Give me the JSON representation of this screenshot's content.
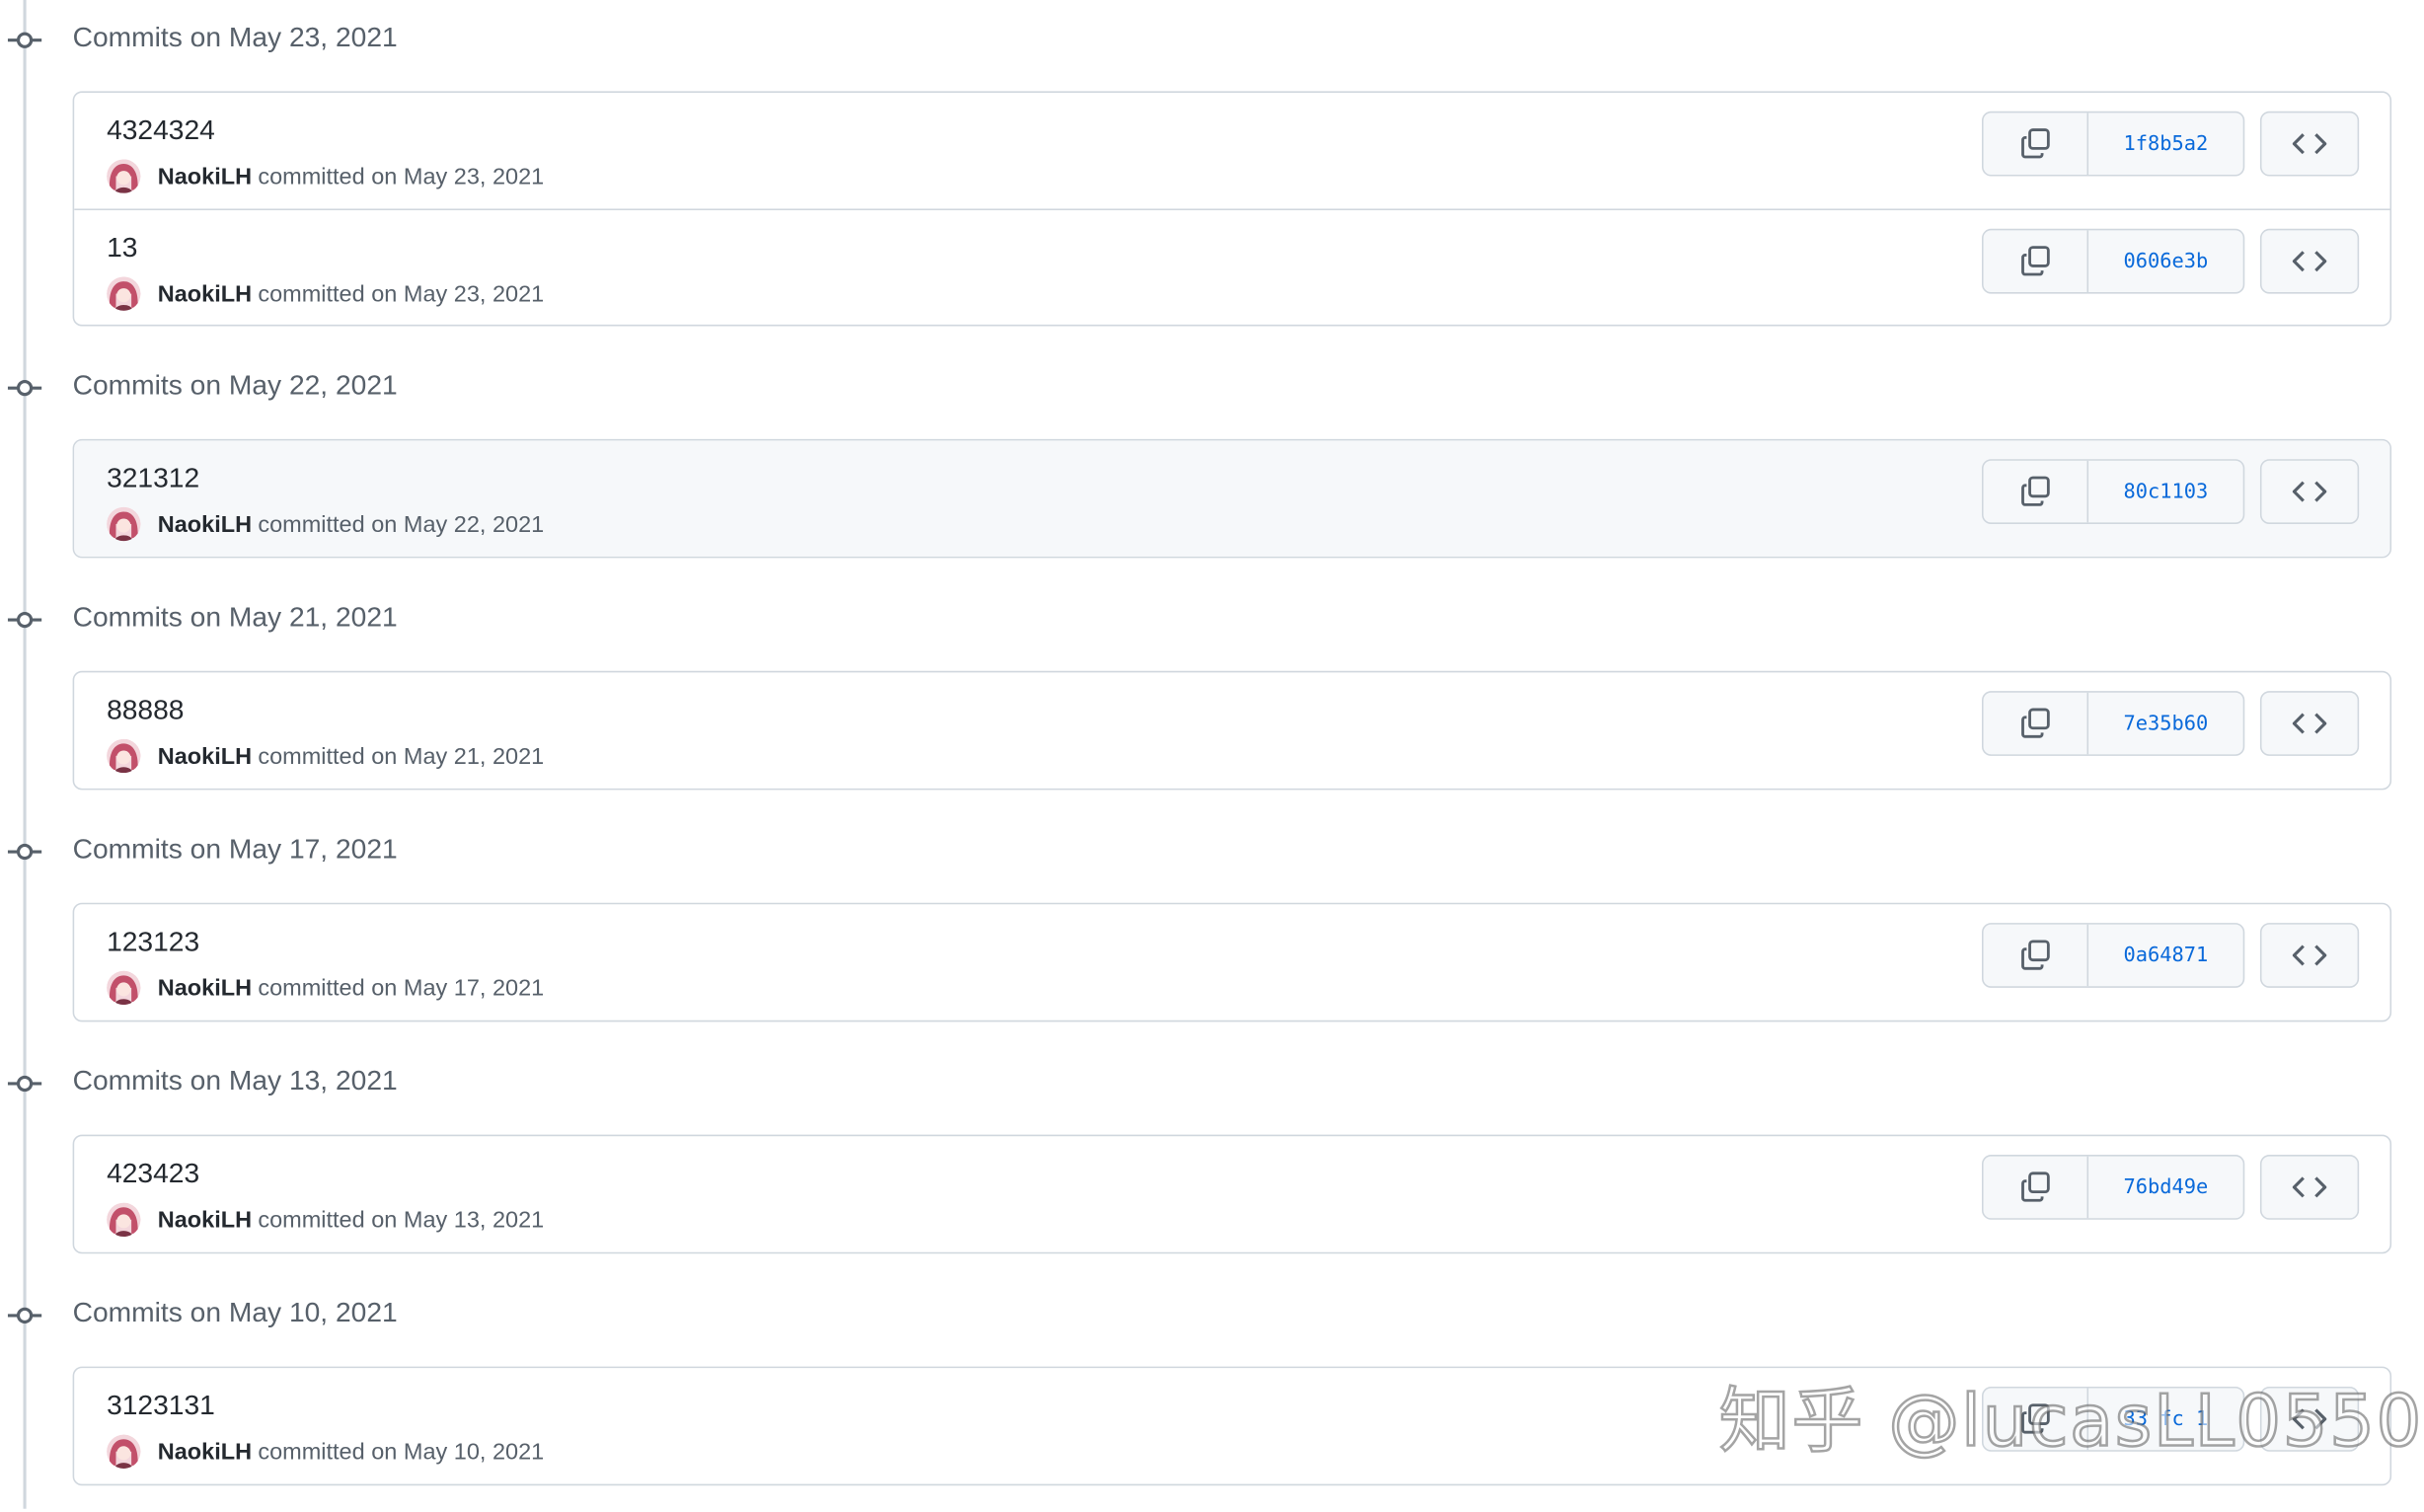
{
  "groups": [
    {
      "title": "Commits on May 23, 2021",
      "commits": [
        {
          "message": "4324324",
          "author": "NaokiLH",
          "committed_text": "committed on May 23, 2021",
          "sha": "1f8b5a2"
        },
        {
          "message": "13",
          "author": "NaokiLH",
          "committed_text": "committed on May 23, 2021",
          "sha": "0606e3b"
        }
      ]
    },
    {
      "title": "Commits on May 22, 2021",
      "commits": [
        {
          "message": "321312",
          "author": "NaokiLH",
          "committed_text": "committed on May 22, 2021",
          "sha": "80c1103"
        }
      ]
    },
    {
      "title": "Commits on May 21, 2021",
      "commits": [
        {
          "message": "88888",
          "author": "NaokiLH",
          "committed_text": "committed on May 21, 2021",
          "sha": "7e35b60"
        }
      ]
    },
    {
      "title": "Commits on May 17, 2021",
      "commits": [
        {
          "message": "123123",
          "author": "NaokiLH",
          "committed_text": "committed on May 17, 2021",
          "sha": "0a64871"
        }
      ]
    },
    {
      "title": "Commits on May 13, 2021",
      "commits": [
        {
          "message": "423423",
          "author": "NaokiLH",
          "committed_text": "committed on May 13, 2021",
          "sha": "76bd49e"
        }
      ]
    },
    {
      "title": "Commits on May 10, 2021",
      "commits": [
        {
          "message": "3123131",
          "author": "NaokiLH",
          "committed_text": "committed on May 10, 2021",
          "sha": "33 fc 1"
        }
      ]
    }
  ],
  "icons": {
    "commit": "git-commit-icon",
    "copy": "copy-icon",
    "browse": "code-icon",
    "avatar": "user-avatar"
  },
  "colors": {
    "link": "#0969da",
    "border": "#d0d7de",
    "muted": "#57606a"
  },
  "watermark": "知乎 @lucasLL0550"
}
